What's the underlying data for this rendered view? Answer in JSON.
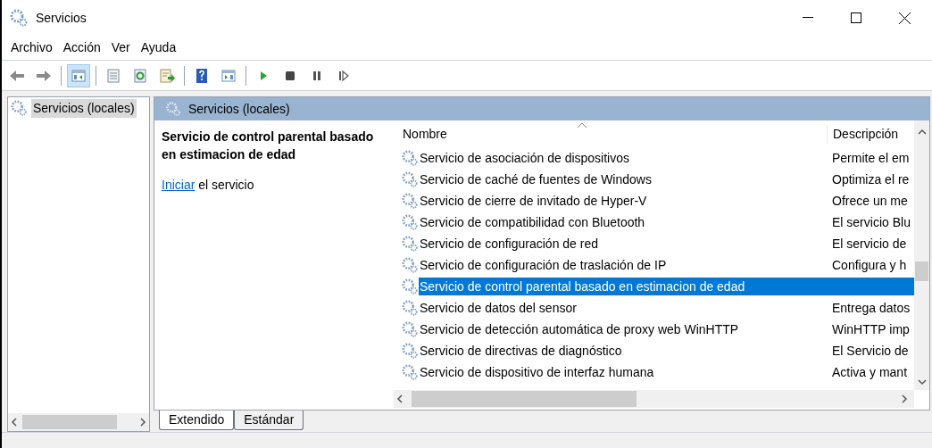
{
  "window": {
    "title": "Servicios"
  },
  "menu": [
    "Archivo",
    "Acción",
    "Ver",
    "Ayuda"
  ],
  "toolbar": [
    {
      "kind": "back",
      "pressed": false
    },
    {
      "kind": "forward",
      "pressed": false
    },
    {
      "kind": "sep"
    },
    {
      "kind": "tree",
      "pressed": true
    },
    {
      "kind": "sep"
    },
    {
      "kind": "props",
      "pressed": false
    },
    {
      "kind": "refresh",
      "pressed": false
    },
    {
      "kind": "export",
      "pressed": false
    },
    {
      "kind": "sep"
    },
    {
      "kind": "help",
      "pressed": false
    },
    {
      "kind": "pane",
      "pressed": false
    },
    {
      "kind": "sep"
    },
    {
      "kind": "play",
      "pressed": false
    },
    {
      "kind": "stop",
      "pressed": false
    },
    {
      "kind": "pause",
      "pressed": false
    },
    {
      "kind": "resume",
      "pressed": false
    }
  ],
  "tree": {
    "items": [
      {
        "label": "Servicios (locales)",
        "selected": true
      }
    ]
  },
  "panel": {
    "title": "Servicios (locales)",
    "service_name": "Servicio de control parental basado en estimacion de edad",
    "link": "Iniciar",
    "link_suffix": " el servicio"
  },
  "table": {
    "columns": [
      "Nombre",
      "Descripción"
    ],
    "rows": [
      {
        "name": "Servicio de asociación de dispositivos",
        "description": "Permite el em",
        "selected": false
      },
      {
        "name": "Servicio de caché de fuentes de Windows",
        "description": "Optimiza el re",
        "selected": false
      },
      {
        "name": "Servicio de cierre de invitado de Hyper-V",
        "description": "Ofrece un me",
        "selected": false
      },
      {
        "name": "Servicio de compatibilidad con Bluetooth",
        "description": "El servicio Blu",
        "selected": false
      },
      {
        "name": "Servicio de configuración de red",
        "description": "El servicio de",
        "selected": false
      },
      {
        "name": "Servicio de configuración de traslación de IP",
        "description": "Configura y h",
        "selected": false
      },
      {
        "name": "Servicio de control parental basado en estimacion de edad",
        "description": "",
        "selected": true
      },
      {
        "name": "Servicio de datos del sensor",
        "description": "Entrega datos",
        "selected": false
      },
      {
        "name": "Servicio de detección automática de proxy web WinHTTP",
        "description": "WinHTTP imp",
        "selected": false
      },
      {
        "name": "Servicio de directivas de diagnóstico",
        "description": "El Servicio de",
        "selected": false
      },
      {
        "name": "Servicio de dispositivo de interfaz humana",
        "description": "Activa y mant",
        "selected": false
      }
    ]
  },
  "tabs": [
    {
      "label": "Extendido",
      "selected": true
    },
    {
      "label": "Estándar",
      "selected": false
    }
  ]
}
